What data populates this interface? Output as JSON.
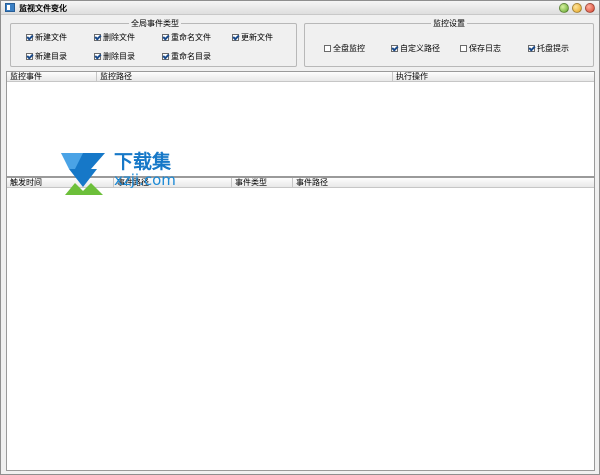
{
  "window": {
    "title": "监视文件变化"
  },
  "event_types_group": {
    "title": "全局事件类型",
    "options": [
      {
        "label": "新建文件",
        "checked": true
      },
      {
        "label": "删除文件",
        "checked": true
      },
      {
        "label": "重命名文件",
        "checked": true
      },
      {
        "label": "更新文件",
        "checked": true
      },
      {
        "label": "新建目录",
        "checked": true
      },
      {
        "label": "删除目录",
        "checked": true
      },
      {
        "label": "重命名目录",
        "checked": true
      }
    ]
  },
  "monitor_settings_group": {
    "title": "监控设置",
    "options": [
      {
        "label": "全盘监控",
        "checked": false
      },
      {
        "label": "自定义路径",
        "checked": true
      },
      {
        "label": "保存日志",
        "checked": false
      },
      {
        "label": "托盘提示",
        "checked": true
      }
    ]
  },
  "monitor_list": {
    "columns": [
      "监控事件",
      "监控路径",
      "执行操作"
    ]
  },
  "event_log": {
    "columns": [
      "触发时间",
      "事件路径",
      "事件类型",
      "事件路径"
    ]
  },
  "watermark": {
    "brand": "下载集",
    "url": "xzji.com"
  },
  "colors": {
    "accent": "#1678c8",
    "checkmark": "#1a4a8a"
  }
}
